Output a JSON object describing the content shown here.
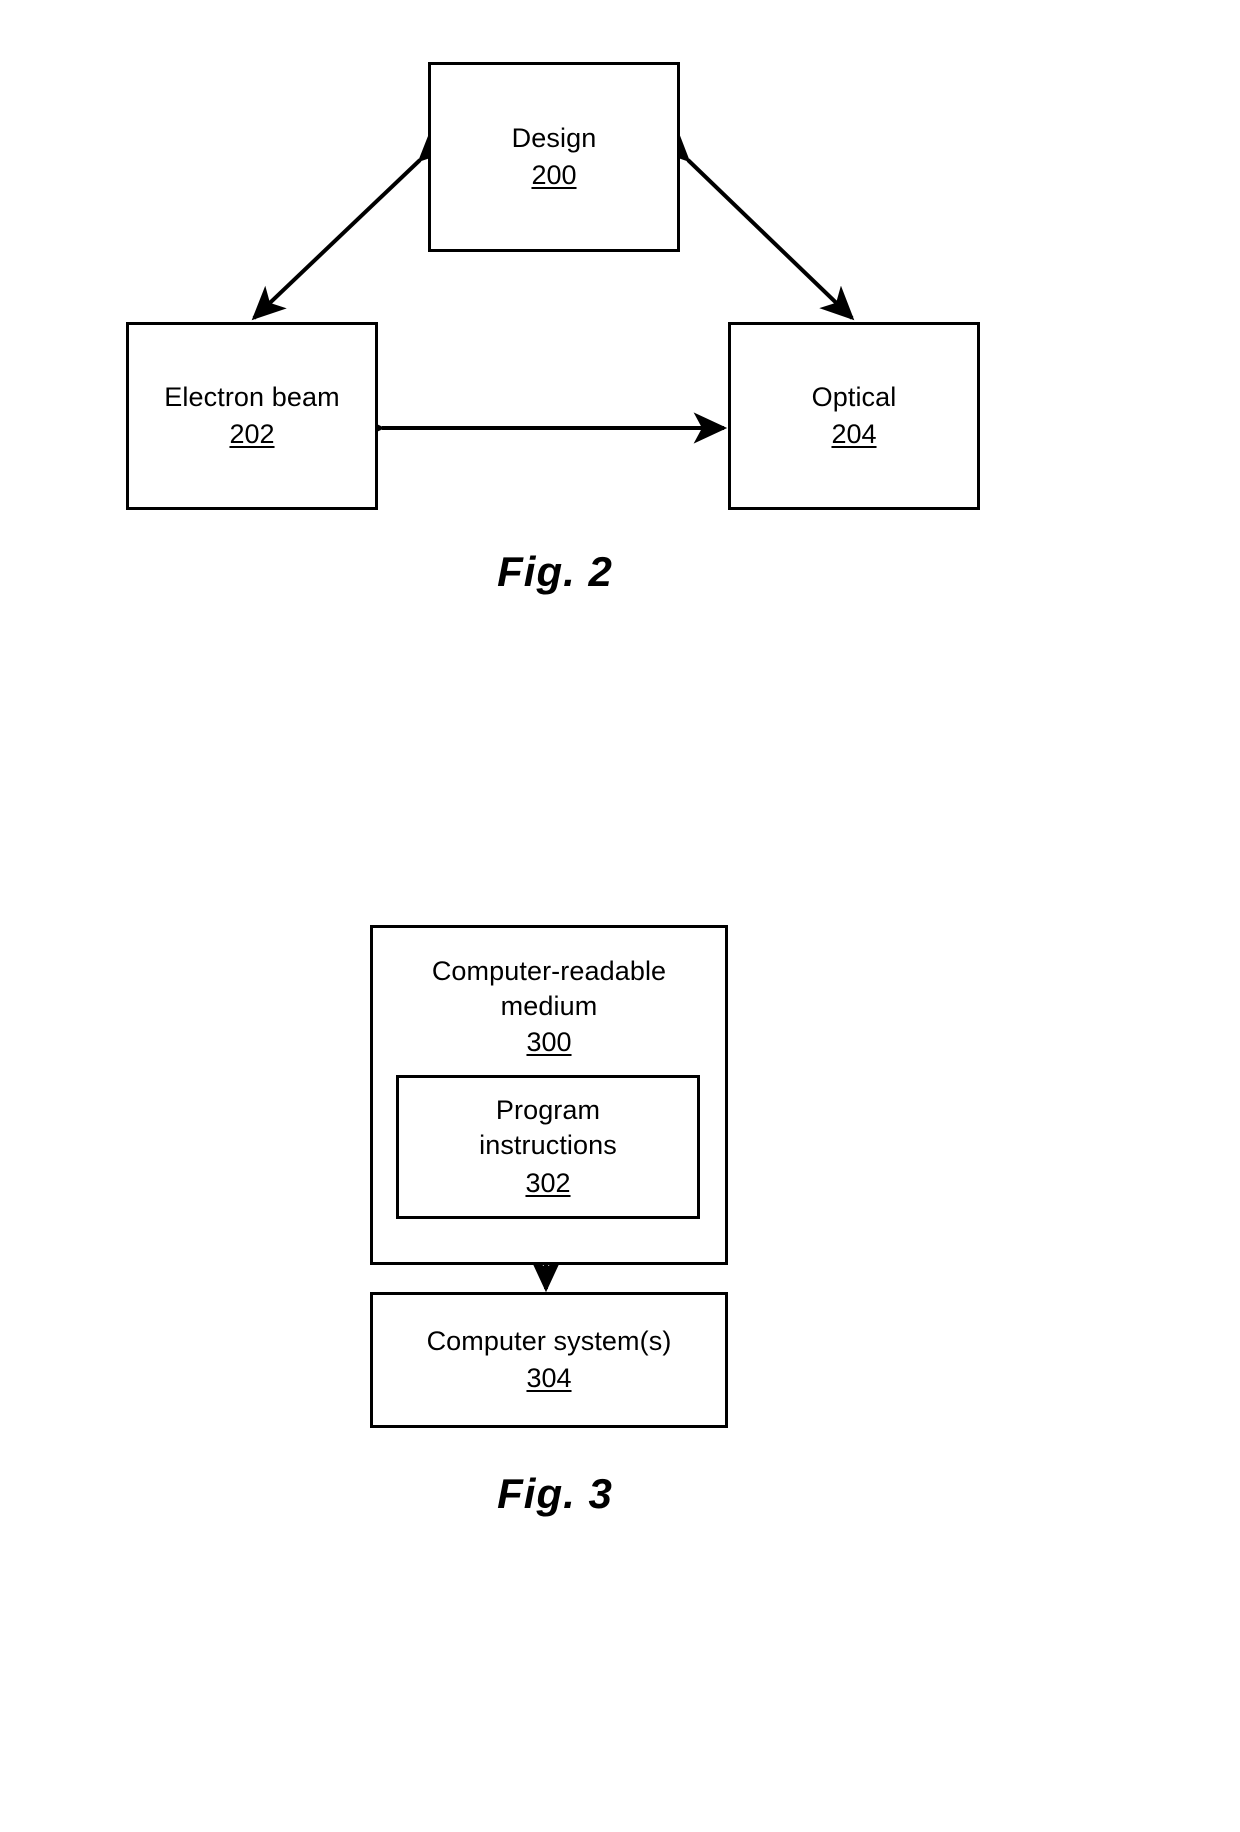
{
  "document": {
    "type": "patent-drawing-sheet",
    "background_color": "#ffffff",
    "line_color": "#000000"
  },
  "figures": [
    {
      "id": "fig2",
      "caption": "Fig. 2",
      "nodes": [
        {
          "id": "design",
          "label": "Design",
          "ref": "200"
        },
        {
          "id": "electron",
          "label": "Electron beam",
          "ref": "202"
        },
        {
          "id": "optical",
          "label": "Optical",
          "ref": "204"
        }
      ],
      "connections": [
        {
          "from": "design",
          "to": "electron",
          "style": "double-arrow",
          "direction": "bidirectional"
        },
        {
          "from": "design",
          "to": "optical",
          "style": "double-arrow",
          "direction": "bidirectional"
        },
        {
          "from": "electron",
          "to": "optical",
          "style": "double-arrow",
          "direction": "bidirectional"
        }
      ]
    },
    {
      "id": "fig3",
      "caption": "Fig. 3",
      "nodes": [
        {
          "id": "crm",
          "label": "Computer-readable\nmedium",
          "ref": "300"
        },
        {
          "id": "program",
          "label": "Program\ninstructions",
          "ref": "302"
        },
        {
          "id": "computersys",
          "label": "Computer system(s)",
          "ref": "304"
        }
      ],
      "connections": [
        {
          "from": "program",
          "to": "computersys",
          "style": "double-arrow",
          "direction": "bidirectional"
        }
      ],
      "containment": [
        {
          "parent": "crm",
          "child": "program"
        }
      ]
    }
  ],
  "fig2": {
    "caption": "Fig. 2",
    "design": {
      "label": "Design",
      "ref": "200"
    },
    "electron": {
      "label": "Electron beam",
      "ref": "202"
    },
    "optical": {
      "label": "Optical",
      "ref": "204"
    }
  },
  "fig3": {
    "caption": "Fig. 3",
    "crm": {
      "label": "Computer-readable\nmedium",
      "ref": "300"
    },
    "program": {
      "label": "Program\ninstructions",
      "ref": "302"
    },
    "computersys": {
      "label": "Computer system(s)",
      "ref": "304"
    }
  }
}
